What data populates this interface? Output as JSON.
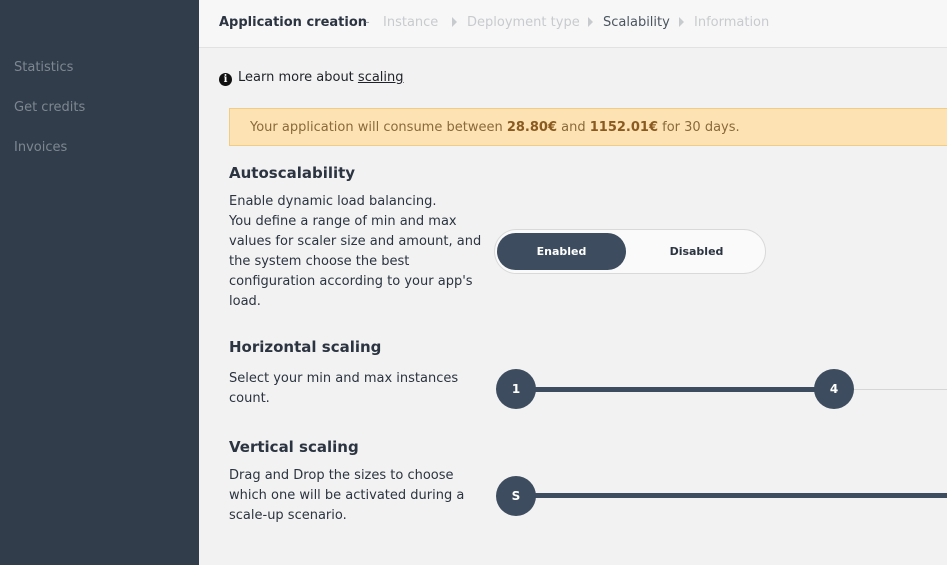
{
  "sidebar": {
    "items": [
      {
        "label": "Statistics"
      },
      {
        "label": "Get credits"
      },
      {
        "label": "Invoices"
      }
    ]
  },
  "header": {
    "title": "Application creation",
    "separator": "-",
    "steps": [
      {
        "label": "Instance",
        "state": "inactive"
      },
      {
        "label": "Deployment type",
        "state": "inactive"
      },
      {
        "label": "Scalability",
        "state": "active"
      },
      {
        "label": "Information",
        "state": "inactive"
      }
    ]
  },
  "learn_more": {
    "icon": "info-icon",
    "text": "Learn more about",
    "link": "scaling"
  },
  "banner": {
    "prefix": "Your application will consume between",
    "min": "28.80€",
    "middle": "and",
    "max": "1152.01€",
    "suffix": "for 30 days.",
    "color": "#fde2b3"
  },
  "autoscalability": {
    "title": "Autoscalability",
    "description": [
      "Enable dynamic load balancing.",
      "You define a range of min and max",
      "values for scaler size and amount, and",
      "the system choose the best",
      "configuration according to your app's",
      "load."
    ],
    "options": [
      "Enabled",
      "Disabled"
    ],
    "selected": "Enabled"
  },
  "horizontal": {
    "title": "Horizontal scaling",
    "description": [
      "Select your min and max instances",
      "count."
    ],
    "min_value": "1",
    "max_value": "4"
  },
  "vertical": {
    "title": "Vertical scaling",
    "description": [
      "Drag and Drop the sizes to choose",
      "which one will be activated during a",
      "scale-up scenario."
    ],
    "size_label": "S"
  },
  "colors": {
    "sidebar": "#313d4a",
    "accent": "#3d4c5e",
    "background": "#f2f2f2"
  }
}
